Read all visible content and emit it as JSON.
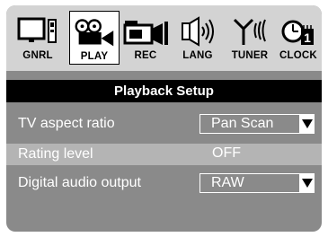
{
  "tabs": [
    {
      "label": "GNRL",
      "icon": "tv-general-icon",
      "active": false
    },
    {
      "label": "PLAY",
      "icon": "film-reel-play-icon",
      "active": true
    },
    {
      "label": "REC",
      "icon": "camera-record-icon",
      "active": false
    },
    {
      "label": "LANG",
      "icon": "speaker-language-icon",
      "active": false
    },
    {
      "label": "TUNER",
      "icon": "antenna-tuner-icon",
      "active": false
    },
    {
      "label": "CLOCK",
      "icon": "clock-icon",
      "active": false
    }
  ],
  "title": "Playback Setup",
  "settings": [
    {
      "label": "TV aspect ratio",
      "value": "Pan Scan",
      "has_dropdown": true,
      "highlighted": false
    },
    {
      "label": "Rating level",
      "value": "OFF",
      "has_dropdown": false,
      "highlighted": true
    },
    {
      "label": "Digital audio output",
      "value": "RAW",
      "has_dropdown": true,
      "highlighted": false
    }
  ],
  "colors": {
    "panel": "#8a8a8a",
    "tab_strip": "#d3d3d3",
    "title_bar": "#000000",
    "highlight_row": "#b4b4b4",
    "text": "#ffffff"
  }
}
